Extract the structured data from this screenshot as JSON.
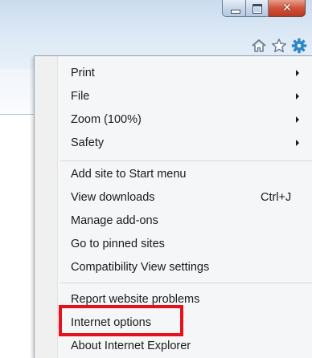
{
  "window": {
    "close_glyph": "✕"
  },
  "toolbar": {
    "icons": [
      "home-icon",
      "star-icon",
      "gear-icon"
    ]
  },
  "menu": {
    "items": [
      {
        "label": "Print",
        "submenu": true
      },
      {
        "label": "File",
        "submenu": true
      },
      {
        "label": "Zoom (100%)",
        "submenu": true
      },
      {
        "label": "Safety",
        "submenu": true
      },
      {
        "label": "Add site to Start menu"
      },
      {
        "label": "View downloads",
        "shortcut": "Ctrl+J"
      },
      {
        "label": "Manage add-ons"
      },
      {
        "label": "Go to pinned sites"
      },
      {
        "label": "Compatibility View settings"
      },
      {
        "label": "Report website problems"
      },
      {
        "label": "Internet options",
        "highlighted": true
      },
      {
        "label": "About Internet Explorer"
      }
    ]
  },
  "colors": {
    "highlight_border": "#e8101a",
    "close_button": "#d0533a",
    "gear": "#2f86c5"
  }
}
